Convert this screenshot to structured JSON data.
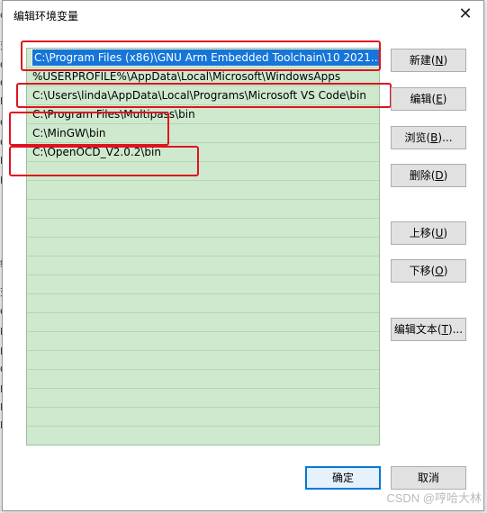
{
  "dialog": {
    "title": "编辑环境变量",
    "close_glyph": "✕"
  },
  "list": {
    "entries": [
      "C:\\Program Files (x86)\\GNU Arm Embedded Toolchain\\10 2021...",
      "%USERPROFILE%\\AppData\\Local\\Microsoft\\WindowsApps",
      "C:\\Users\\linda\\AppData\\Local\\Programs\\Microsoft VS Code\\bin",
      "C:\\Program Files\\Multipass\\bin",
      "C:\\MinGW\\bin",
      "C:\\OpenOCD_V2.0.2\\bin"
    ],
    "selected_index": 0
  },
  "buttons": {
    "new": {
      "label": "新建(",
      "key": "N",
      "suffix": ")"
    },
    "edit": {
      "label": "编辑(",
      "key": "E",
      "suffix": ")"
    },
    "browse": {
      "label": "浏览(",
      "key": "B",
      "suffix": ")..."
    },
    "delete": {
      "label": "删除(",
      "key": "D",
      "suffix": ")"
    },
    "move_up": {
      "label": "上移(",
      "key": "U",
      "suffix": ")"
    },
    "move_down": {
      "label": "下移(",
      "key": "O",
      "suffix": ")"
    },
    "edit_text": {
      "label": "编辑文本(",
      "key": "T",
      "suffix": ")..."
    },
    "ok": "确定",
    "cancel": "取消"
  },
  "watermark": "CSDN @哼哈大林"
}
